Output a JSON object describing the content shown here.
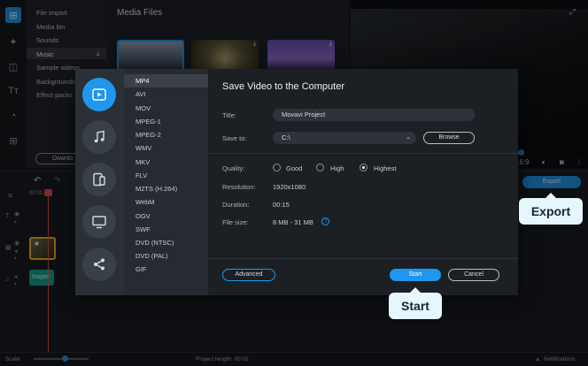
{
  "import_panel": {
    "items": [
      "File import",
      "Media bin",
      "Sounds",
      "Music",
      "Sample videos",
      "Backgrounds",
      "Effect packs"
    ],
    "download_label": "Downlo"
  },
  "media": {
    "title": "Media Files"
  },
  "player": {
    "aspect": "16:9"
  },
  "export_button": "Export",
  "timeline": {
    "ruler_time": "00:00",
    "audio_clip": "Inspec"
  },
  "statusbar": {
    "scale_label": "Scale:",
    "project_length": "Project length: 00:02",
    "notifications": "Notifications"
  },
  "dialog": {
    "title": "Save Video to the Computer",
    "formats": [
      "MP4",
      "AVI",
      "MOV",
      "MPEG-1",
      "MPEG-2",
      "WMV",
      "MKV",
      "FLV",
      "M2TS (H.264)",
      "WebM",
      "OGV",
      "SWF",
      "DVD (NTSC)",
      "DVD (PAL)",
      "GIF"
    ],
    "selected_format": "MP4",
    "title_label": "Title:",
    "title_value": "Movavi Project",
    "save_to_label": "Save to:",
    "save_to_value": "C:\\",
    "browse_label": "Browse",
    "quality_label": "Quality:",
    "quality_options": [
      "Good",
      "High",
      "Highest"
    ],
    "quality_selected": "Highest",
    "resolution_label": "Resolution:",
    "resolution_value": "1920x1080",
    "duration_label": "Duration:",
    "duration_value": "00:15",
    "file_size_label": "File size:",
    "file_size_value": "8 MB - 31 MB",
    "advanced_label": "Advanced",
    "start_label": "Start",
    "cancel_label": "Cancel"
  },
  "callouts": {
    "export": "Export",
    "start": "Start"
  },
  "colors": {
    "accent": "#1f97ee",
    "callout_bg": "#e6f6fd",
    "clip_border": "#f0b429",
    "audio_clip": "#17a590",
    "playhead": "#e0524e"
  }
}
